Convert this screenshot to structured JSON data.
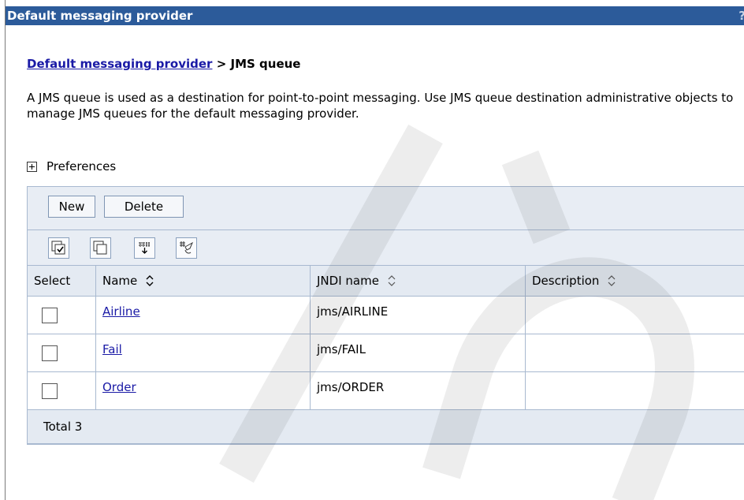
{
  "titlebar": {
    "title": "Default messaging provider",
    "help": "?"
  },
  "breadcrumb": {
    "parent": "Default messaging provider",
    "separator": ">",
    "current": "JMS queue"
  },
  "description": "A JMS queue is used as a destination for point-to-point messaging. Use JMS queue destination administrative objects to manage JMS queues for the default messaging provider.",
  "preferences": {
    "label": "Preferences"
  },
  "buttons": {
    "new": "New",
    "delete": "Delete"
  },
  "toolbar_icons": [
    "select-all-icon",
    "deselect-all-icon",
    "show-filter-icon",
    "clear-filter-icon"
  ],
  "table": {
    "columns": [
      "Select",
      "Name",
      "JNDI name",
      "Description"
    ],
    "rows": [
      {
        "name": "Airline",
        "jndi": "jms/AIRLINE",
        "description": ""
      },
      {
        "name": "Fail",
        "jndi": "jms/FAIL",
        "description": ""
      },
      {
        "name": "Order",
        "jndi": "jms/ORDER",
        "description": ""
      }
    ],
    "total": "Total 3"
  },
  "colors": {
    "titlebar": "#2c5b9a",
    "link": "#1a1aa6",
    "panel": "#e8edf4",
    "border": "#a8b9d0"
  }
}
